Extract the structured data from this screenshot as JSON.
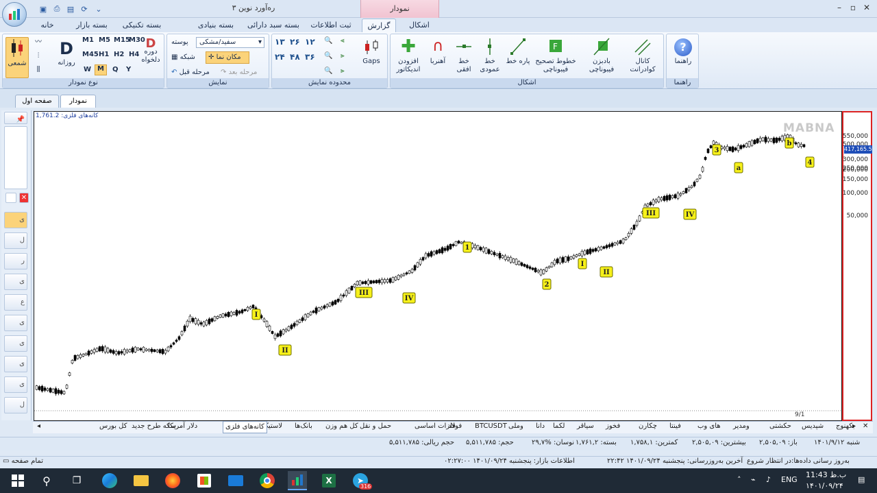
{
  "title_bar": {
    "window_title": "ره‌آورد نوین ۳",
    "context_tab": "نمودار"
  },
  "tabs": [
    "خانه",
    "بسته بازار",
    "بسته تکنیکی",
    "بسته بنیادی",
    "بسته سبد دارائی",
    "ثبت اطلاعات",
    "گزارش",
    "اشکال"
  ],
  "ribbon": {
    "chart_type": {
      "caption": "نوع نمودار",
      "candle_label": "شمعی",
      "daily_label": "روزانه",
      "custom_period_label": "دوره دلخواه",
      "timeframes": [
        "M1",
        "M5",
        "M15",
        "M30",
        "M45",
        "H1",
        "H2",
        "H4",
        "W",
        "M",
        "Q",
        "Y"
      ]
    },
    "display": {
      "caption": "نمایش",
      "skin_label": "پوسته",
      "skin_value": "سفید/مشکی",
      "grid_label": "شبکه",
      "cursor_label": "مکان نما",
      "prev_label": "مرحله قبل",
      "next_label": "مرحله بعد"
    },
    "range": {
      "caption": "محدوده نمایش",
      "buttons": [
        "۱۳",
        "۲۶",
        "۱۲",
        "۲۴",
        "۴۸",
        "۳۶"
      ],
      "gaps_label": "Gaps"
    },
    "shapes": {
      "caption": "اشکال",
      "add_indicator": "افزودن اندیکاتور",
      "magnet": "آهنربا",
      "horizontal_line": "خط افقی",
      "vertical_line": "خط عمودی",
      "segment": "پاره خط",
      "fib_retracement": "خطوط تصحیح فیبوناچی",
      "fib_fan": "بادبزن فیبوناچی",
      "quadrant_channel": "کانال کوادرانت"
    },
    "help": {
      "caption": "راهنما",
      "label": "راهنما"
    }
  },
  "doc_tabs": {
    "first_page": "صفحه اول",
    "chart": "نمودار"
  },
  "chart": {
    "header_label": "کانه‌های فلزی: 1,761.2",
    "watermark": "MABNA",
    "price_tag": "417,165.5",
    "date_label": "9/1",
    "y_ticks": [
      "550,000",
      "500,000",
      "300,000",
      "250,000",
      "200,000",
      "150,000",
      "100,000",
      "50,000"
    ],
    "wave_labels": [
      "I",
      "II",
      "III",
      "IV",
      "1",
      "2",
      "I",
      "II",
      "III",
      "IV",
      "3",
      "a",
      "b",
      "4"
    ]
  },
  "symbols": [
    "بکهنوج",
    "شپدیس",
    "حکشتی",
    "ومدیر",
    "های وب",
    "فینتا",
    "چکارن",
    "فخوز",
    "سیاقر",
    "لکما",
    "دانا",
    "وملی",
    "BTCUSDT",
    "فولاد",
    "فلزات اساسی",
    "حمل و نقل",
    "کل هم وزن",
    "بانک‌ها",
    "لاستیک",
    "کانه‌های فلزی",
    "دلار آمریکا",
    "سکه طرح جدید",
    "کل بورس"
  ],
  "active_symbol": "کانه‌های فلزی",
  "info_bar": {
    "date": "شنبه ۱۴۰۱/۹/۱۲",
    "open": "باز: ۲,۵۰۵,۰۹",
    "high": "بیشترین: ۲,۵۰۵,۰۹",
    "low": "کمترین: ۱,۷۵۸,۱",
    "close": "بسته: ۱,۷۶۱,۲",
    "change": "نوسان: %۲۹,۷",
    "volume": "حجم: ۵,۵۱۱,۷۸۵",
    "value": "حجم ریالی: ۵,۵۱۱,۷۸۵"
  },
  "status_bar": {
    "full_page": "تمام صفحه",
    "update": "به‌روز رسانی داده‌ها:در انتظار شروع",
    "last_update": "آخرین به‌روزرسانی: پنجشنبه ۱۴۰۱/۰۹/۲۴ ۲۲:۴۲",
    "market_info": "اطلاعات بازار: پنجشنبه ۱۴۰۱/۰۹/۲۴ ۰۲:۲۷:۰۰"
  },
  "taskbar": {
    "time": "11:43 ب.ظ",
    "date": "۱۴۰۱/۰۹/۲۴",
    "lang": "ENG",
    "badge": "316"
  },
  "colors": {
    "accent": "#1f4eb8",
    "highlight_box": "#d22222",
    "label_yellow": "#f7f11a"
  }
}
